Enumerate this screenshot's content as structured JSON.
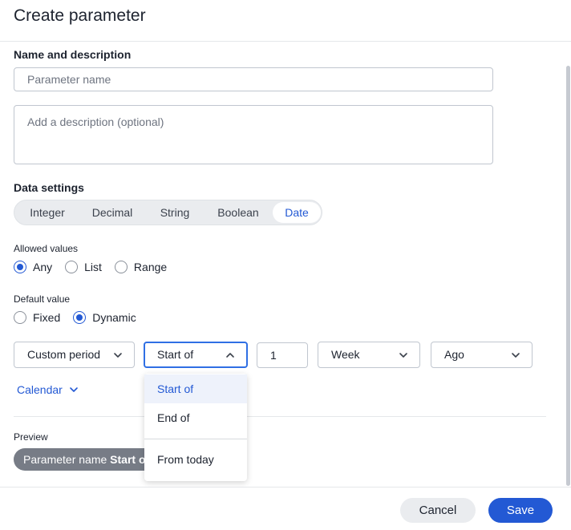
{
  "dialog": {
    "title": "Create parameter"
  },
  "name_section": {
    "label": "Name and description",
    "name_placeholder": "Parameter name",
    "description_placeholder": "Add a description (optional)"
  },
  "data_settings": {
    "label": "Data settings",
    "types": [
      "Integer",
      "Decimal",
      "String",
      "Boolean",
      "Date"
    ],
    "selected_type": "Date"
  },
  "allowed_values": {
    "label": "Allowed values",
    "options": [
      "Any",
      "List",
      "Range"
    ],
    "selected": "Any"
  },
  "default_value": {
    "label": "Default value",
    "options": [
      "Fixed",
      "Dynamic"
    ],
    "selected": "Dynamic"
  },
  "dynamic": {
    "period": "Custom period",
    "anchor": "Start of",
    "amount": "1",
    "unit": "Week",
    "direction": "Ago",
    "calendar": "Calendar"
  },
  "anchor_menu": {
    "items": [
      "Start of",
      "End of",
      "From today"
    ],
    "selected": "Start of"
  },
  "preview": {
    "label": "Preview",
    "name": "Parameter name",
    "value": "Start of"
  },
  "footer": {
    "cancel": "Cancel",
    "save": "Save"
  },
  "colors": {
    "accent": "#2359d4",
    "pill": "#777c86",
    "border": "#c0c6cf"
  }
}
